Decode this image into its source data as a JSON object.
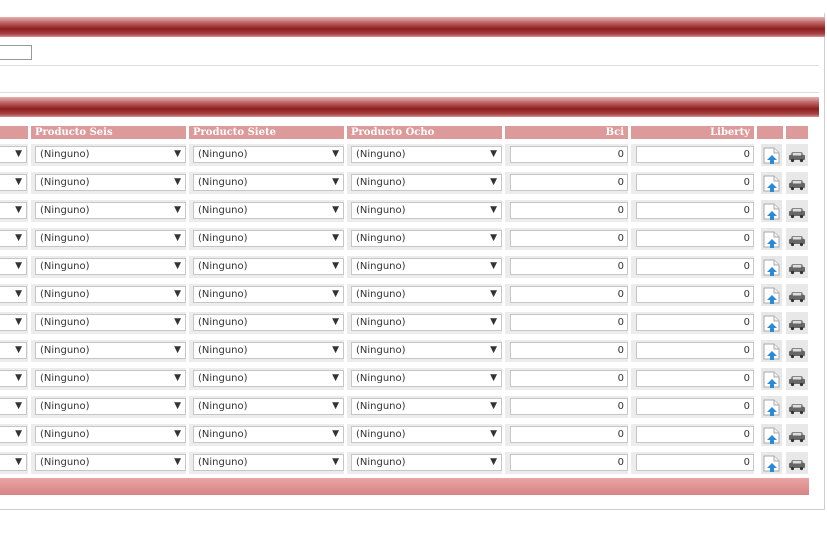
{
  "headers": {
    "col6": "Producto Seis",
    "col7": "Producto Siete",
    "col8": "Producto Ocho",
    "col_bci": "Bci",
    "col_liberty": "Liberty"
  },
  "rows": [
    {
      "p6": "(Ninguno)",
      "p7": "(Ninguno)",
      "p8": "(Ninguno)",
      "bci": "0",
      "liberty": "0"
    },
    {
      "p6": "(Ninguno)",
      "p7": "(Ninguno)",
      "p8": "(Ninguno)",
      "bci": "0",
      "liberty": "0"
    },
    {
      "p6": "(Ninguno)",
      "p7": "(Ninguno)",
      "p8": "(Ninguno)",
      "bci": "0",
      "liberty": "0"
    },
    {
      "p6": "(Ninguno)",
      "p7": "(Ninguno)",
      "p8": "(Ninguno)",
      "bci": "0",
      "liberty": "0"
    },
    {
      "p6": "(Ninguno)",
      "p7": "(Ninguno)",
      "p8": "(Ninguno)",
      "bci": "0",
      "liberty": "0"
    },
    {
      "p6": "(Ninguno)",
      "p7": "(Ninguno)",
      "p8": "(Ninguno)",
      "bci": "0",
      "liberty": "0"
    },
    {
      "p6": "(Ninguno)",
      "p7": "(Ninguno)",
      "p8": "(Ninguno)",
      "bci": "0",
      "liberty": "0"
    },
    {
      "p6": "(Ninguno)",
      "p7": "(Ninguno)",
      "p8": "(Ninguno)",
      "bci": "0",
      "liberty": "0"
    },
    {
      "p6": "(Ninguno)",
      "p7": "(Ninguno)",
      "p8": "(Ninguno)",
      "bci": "0",
      "liberty": "0"
    },
    {
      "p6": "(Ninguno)",
      "p7": "(Ninguno)",
      "p8": "(Ninguno)",
      "bci": "0",
      "liberty": "0"
    },
    {
      "p6": "(Ninguno)",
      "p7": "(Ninguno)",
      "p8": "(Ninguno)",
      "bci": "0",
      "liberty": "0"
    },
    {
      "p6": "(Ninguno)",
      "p7": "(Ninguno)",
      "p8": "(Ninguno)",
      "bci": "0",
      "liberty": "0"
    }
  ],
  "icons": {
    "row_action_1": "upload-document-icon",
    "row_action_2": "car-icon"
  },
  "colors": {
    "bar_dark": "#8c1f1f",
    "header_bg": "#dc9a9a",
    "footer_bg": "#e09494"
  }
}
